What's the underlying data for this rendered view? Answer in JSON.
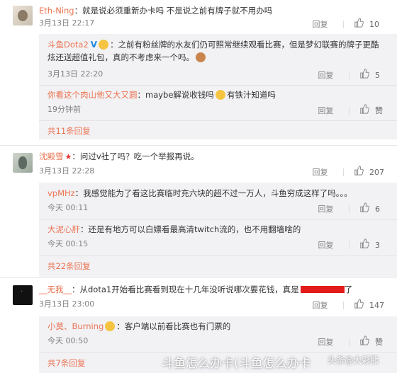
{
  "comments": [
    {
      "user": "Eth-Ning",
      "text": "：就是说必须重新办卡吗 不是说之前有牌子就不用办吗",
      "time": "3月13日 22:17",
      "reply_label": "回复",
      "likes": "10",
      "replies": [
        {
          "user": "斗鱼Dota2",
          "text_line1": "：之前有粉丝牌的水友们仍可照常继续观看比赛，但是梦幻联赛的牌子更酷",
          "text_line2": "炫还送超值礼包，真的不考虑来一个吗。",
          "time": "3月13日 22:20",
          "reply_label": "回复",
          "likes": "5"
        },
        {
          "user": "你看这个肉山他又大又圆",
          "text": "：maybe解说收钱吗",
          "text_after": "有铁汁知道吗",
          "time": "19分钟前",
          "reply_label": "回复",
          "likes": "赞"
        }
      ],
      "more_label": "共11条回复"
    },
    {
      "user": "沈殿雪",
      "text": "：问过v社了吗？吃一个举报再说。",
      "time": "3月13日 22:28",
      "reply_label": "回复",
      "likes": "207",
      "replies": [
        {
          "user": "vpMHz",
          "text": "：我感觉能为了看这比赛临时充六块的超不过一万人，斗鱼穷成这样了吗。。。",
          "time": "今天 00:11",
          "reply_label": "回复",
          "likes": "6"
        },
        {
          "user": "大泥心肝",
          "text": "：还是有地方可以白嫖看最高清twitch流的，也不用翻墙啥的",
          "time": "今天 00:15",
          "reply_label": "回复",
          "likes": "3"
        }
      ],
      "more_label": "共22条回复"
    },
    {
      "user": "__无我__",
      "text": "：从dota1开始看比赛看到现在十几年没听说哪次要花钱，真是",
      "text_after": "了",
      "time": "3月13日 23:00",
      "reply_label": "回复",
      "likes": "147",
      "replies": [
        {
          "user": "小莫、Burning",
          "text": "：客户端以前看比赛也有门票的",
          "time": "今天 00:50",
          "reply_label": "回复",
          "likes": "赞"
        }
      ],
      "more_label": "共7条回复"
    }
  ],
  "watermark": {
    "title": "斗鱼怎么办卡(斗鱼怎么办卡",
    "source": "头条@大彩熊"
  },
  "colors": {
    "username": "#eb7350",
    "meta": "#808080",
    "reply_bg": "#f2f2f5"
  }
}
